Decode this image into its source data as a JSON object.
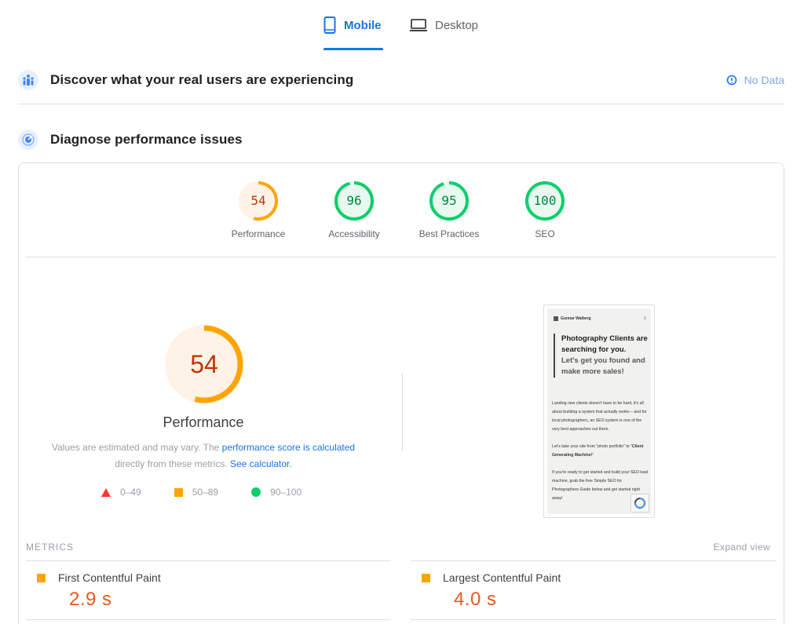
{
  "tabs": {
    "mobile": "Mobile",
    "desktop": "Desktop"
  },
  "real_users": {
    "title": "Discover what your real users are experiencing",
    "status": "No Data"
  },
  "diagnose": {
    "title": "Diagnose performance issues"
  },
  "scores": [
    {
      "label": "Performance",
      "value": "54",
      "fraction": 0.54,
      "status": "average"
    },
    {
      "label": "Accessibility",
      "value": "96",
      "fraction": 0.96,
      "status": "pass"
    },
    {
      "label": "Best Practices",
      "value": "95",
      "fraction": 0.95,
      "status": "pass"
    },
    {
      "label": "SEO",
      "value": "100",
      "fraction": 1.0,
      "status": "pass"
    }
  ],
  "performance": {
    "score": "54",
    "fraction": 0.54,
    "label": "Performance",
    "note_prefix": "Values are estimated and may vary. The ",
    "note_link1": "performance score is calculated",
    "note_middle": "directly from these metrics. ",
    "note_link2": "See calculator."
  },
  "legend": [
    {
      "range": "0–49",
      "shape": "triangle",
      "color": "#ff3333"
    },
    {
      "range": "50–89",
      "shape": "square",
      "color": "#ffa400"
    },
    {
      "range": "90–100",
      "shape": "circle",
      "color": "#0cce6b"
    }
  ],
  "colors": {
    "accent": "#1a73e8",
    "average": "#ffa400",
    "average_text": "#c33300",
    "average_bg": "#fff3e8",
    "pass": "#0cce6b",
    "pass_text": "#018642",
    "pass_bg": "#e8faf0"
  },
  "preview": {
    "site_name": "Gunnar Walberg",
    "hero_dark": "Photography Clients are searching for you.",
    "hero_light": "Let's get you found and make more sales!",
    "para1": "Landing new clients doesn't have to be hard, it's all about building a system that actually works – and for local photographers, an SEO system is one of the very best approaches out there.",
    "para2_prefix": "Let's take your site from \"photo portfolio\" to \"",
    "para2_bold": "Client Generating Machine!",
    "para2_suffix": "\"",
    "para3": "If you're ready to get started and build your SEO lead machine, grab the free Simple SEO for Photographers Guide below and get started right away!"
  },
  "metrics": {
    "heading": "METRICS",
    "expand": "Expand view",
    "items": [
      {
        "name": "First Contentful Paint",
        "value": "2.9 s"
      },
      {
        "name": "Largest Contentful Paint",
        "value": "4.0 s"
      }
    ]
  }
}
